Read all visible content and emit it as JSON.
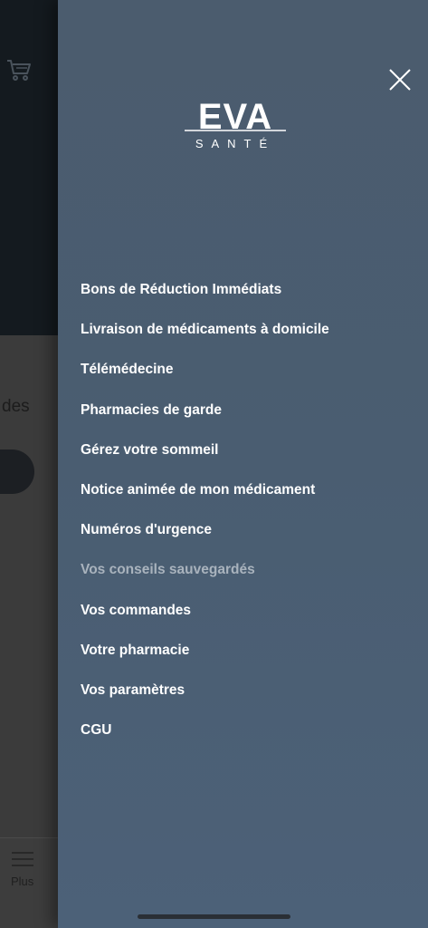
{
  "background_app": {
    "partial_text": "des",
    "tab_bar": {
      "more_label": "Plus"
    },
    "icons": {
      "cart": "cart-icon",
      "menu": "hamburger-icon"
    }
  },
  "drawer": {
    "logo": {
      "wordmark": "EVA",
      "subtitle": "SANTÉ"
    },
    "close_icon": "close-icon",
    "items": [
      {
        "label": "Bons de Réduction Immédiats",
        "active": false
      },
      {
        "label": "Livraison de médicaments à domicile",
        "active": false
      },
      {
        "label": "Télémédecine",
        "active": false
      },
      {
        "label": "Pharmacies de garde",
        "active": false
      },
      {
        "label": "Gérez votre sommeil",
        "active": false
      },
      {
        "label": "Notice animée de mon médicament",
        "active": false
      },
      {
        "label": "Numéros d'urgence",
        "active": false
      },
      {
        "label": "Vos conseils sauvegardés",
        "active": true
      },
      {
        "label": "Vos commandes",
        "active": false
      },
      {
        "label": "Votre pharmacie",
        "active": false
      },
      {
        "label": "Vos paramètres",
        "active": false
      },
      {
        "label": "CGU",
        "active": false
      }
    ],
    "colors": {
      "text": "#ffffff",
      "active_text": "#a9b3bd",
      "background": "#4a5d71"
    }
  }
}
